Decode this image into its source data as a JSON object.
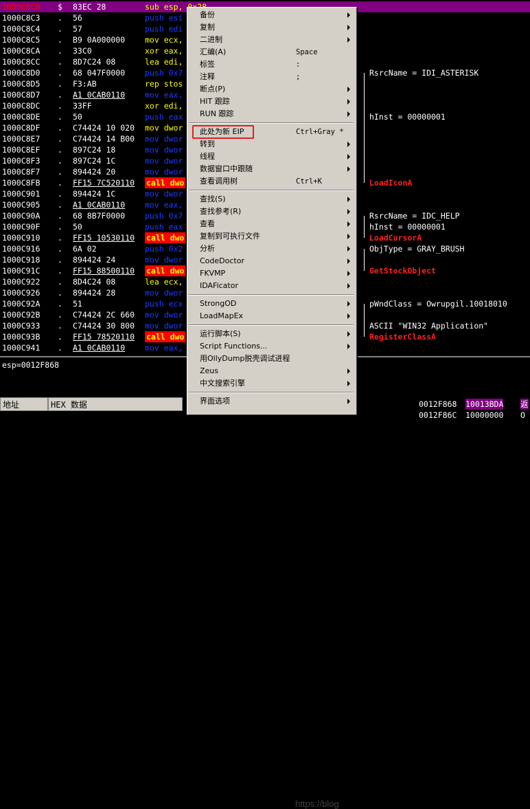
{
  "disasm": {
    "rows": [
      {
        "addr": "1000C8C0",
        "mark": "$",
        "hex": "83EC 28",
        "asm": "sub esp, 0x28",
        "asm_color": "yellow",
        "selected": true
      },
      {
        "addr": "1000C8C3",
        "mark": ".",
        "hex": "56",
        "asm": "push esi",
        "asm_color": "blue"
      },
      {
        "addr": "1000C8C4",
        "mark": ".",
        "hex": "57",
        "asm": "push edi",
        "asm_color": "blue"
      },
      {
        "addr": "1000C8C5",
        "mark": ".",
        "hex": "B9 0A000000",
        "asm": "mov ecx,",
        "asm_color": "yellow"
      },
      {
        "addr": "1000C8CA",
        "mark": ".",
        "hex": "33C0",
        "asm": "xor eax,",
        "asm_color": "yellow"
      },
      {
        "addr": "1000C8CC",
        "mark": ".",
        "hex": "8D7C24 08",
        "asm": "lea edi,",
        "asm_color": "yellow"
      },
      {
        "addr": "1000C8D0",
        "mark": ".",
        "hex": "68 047F0000",
        "asm": "push 0x7",
        "asm_color": "blue"
      },
      {
        "addr": "1000C8D5",
        "mark": ".",
        "hex": "F3:AB",
        "asm": "rep stos",
        "asm_color": "yellow"
      },
      {
        "addr": "1000C8D7",
        "mark": ".",
        "hex": "A1 0CAB0110",
        "asm": "mov eax,",
        "asm_color": "blue",
        "hex_u": true
      },
      {
        "addr": "1000C8DC",
        "mark": ".",
        "hex": "33FF",
        "asm": "xor edi,",
        "asm_color": "yellow"
      },
      {
        "addr": "1000C8DE",
        "mark": ".",
        "hex": "50",
        "asm": "push eax",
        "asm_color": "blue"
      },
      {
        "addr": "1000C8DF",
        "mark": ".",
        "hex": "C74424 10 020",
        "asm": "mov dwor",
        "asm_color": "yellow"
      },
      {
        "addr": "1000C8E7",
        "mark": ".",
        "hex": "C74424 14 B00",
        "asm": "mov dwor",
        "asm_color": "blue"
      },
      {
        "addr": "1000C8EF",
        "mark": ".",
        "hex": "897C24 18",
        "asm": "mov dwor",
        "asm_color": "blue"
      },
      {
        "addr": "1000C8F3",
        "mark": ".",
        "hex": "897C24 1C",
        "asm": "mov dwor",
        "asm_color": "blue"
      },
      {
        "addr": "1000C8F7",
        "mark": ".",
        "hex": "894424 20",
        "asm": "mov dwor",
        "asm_color": "blue"
      },
      {
        "addr": "1000C8FB",
        "mark": ".",
        "hex": "FF15 7C520110",
        "asm": "call dwo",
        "asm_color": "call",
        "hex_u": true
      },
      {
        "addr": "1000C901",
        "mark": ".",
        "hex": "894424 1C",
        "asm": "mov dwor",
        "asm_color": "blue"
      },
      {
        "addr": "1000C905",
        "mark": ".",
        "hex": "A1 0CAB0110",
        "asm": "mov eax,",
        "asm_color": "blue",
        "hex_u": true
      },
      {
        "addr": "1000C90A",
        "mark": ".",
        "hex": "68 8B7F0000",
        "asm": "push 0x7",
        "asm_color": "blue"
      },
      {
        "addr": "1000C90F",
        "mark": ".",
        "hex": "50",
        "asm": "push eax",
        "asm_color": "blue"
      },
      {
        "addr": "1000C910",
        "mark": ".",
        "hex": "FF15 10530110",
        "asm": "call dwo",
        "asm_color": "call",
        "hex_u": true
      },
      {
        "addr": "1000C916",
        "mark": ".",
        "hex": "6A 02",
        "asm": "push 0x2",
        "asm_color": "blue"
      },
      {
        "addr": "1000C918",
        "mark": ".",
        "hex": "894424 24",
        "asm": "mov dwor",
        "asm_color": "blue"
      },
      {
        "addr": "1000C91C",
        "mark": ".",
        "hex": "FF15 88500110",
        "asm": "call dwo",
        "asm_color": "call",
        "hex_u": true
      },
      {
        "addr": "1000C922",
        "mark": ".",
        "hex": "8D4C24 08",
        "asm": "lea ecx,",
        "asm_color": "yellow"
      },
      {
        "addr": "1000C926",
        "mark": ".",
        "hex": "894424 28",
        "asm": "mov dwor",
        "asm_color": "blue"
      },
      {
        "addr": "1000C92A",
        "mark": ".",
        "hex": "51",
        "asm": "push ecx",
        "asm_color": "blue"
      },
      {
        "addr": "1000C92B",
        "mark": ".",
        "hex": "C74424 2C 660",
        "asm": "mov dwor",
        "asm_color": "blue"
      },
      {
        "addr": "1000C933",
        "mark": ".",
        "hex": "C74424 30 800",
        "asm": "mov dwor",
        "asm_color": "blue"
      },
      {
        "addr": "1000C93B",
        "mark": ".",
        "hex": "FF15 78520110",
        "asm": "call dwo",
        "asm_color": "call",
        "hex_u": true
      },
      {
        "addr": "1000C941",
        "mark": ".",
        "hex": "A1 0CAB0110",
        "asm": "mov eax,",
        "asm_color": "blue",
        "hex_u": true
      }
    ],
    "comments": [
      {
        "row": 6,
        "text": "RsrcName = IDI_ASTERISK",
        "color": "white"
      },
      {
        "row": 10,
        "text": "hInst = 00000001",
        "color": "white"
      },
      {
        "row": 16,
        "text": "LoadIconA",
        "color": "red"
      },
      {
        "row": 19,
        "text": "RsrcName = IDC_HELP",
        "color": "white"
      },
      {
        "row": 20,
        "text": "hInst = 00000001",
        "color": "white"
      },
      {
        "row": 21,
        "text": "LoadCursorA",
        "color": "red"
      },
      {
        "row": 22,
        "text": "ObjType = GRAY_BRUSH",
        "color": "white"
      },
      {
        "row": 24,
        "text": "GetStockObject",
        "color": "red"
      },
      {
        "row": 27,
        "text": "pWndClass = Owrupgil.10018010",
        "color": "white"
      },
      {
        "row": 29,
        "text": "ASCII \"WIN32 Application\"",
        "color": "white"
      },
      {
        "row": 30,
        "text": "RegisterClassA",
        "color": "red"
      }
    ]
  },
  "infobar": {
    "text": "esp=0012F868"
  },
  "bottom": {
    "addr_header": "地址",
    "hex_header": "HEX 数据",
    "stack": [
      {
        "addr": "0012F868",
        "value": "10013BDA",
        "extra": "返",
        "highlight": true
      },
      {
        "addr": "0012F86C",
        "value": "10000000",
        "extra": "O",
        "highlight": false
      }
    ]
  },
  "context_menu": {
    "items": [
      {
        "type": "item",
        "label": "备份",
        "shortcut": "",
        "submenu": true
      },
      {
        "type": "item",
        "label": "复制",
        "shortcut": "",
        "submenu": true
      },
      {
        "type": "item",
        "label": "二进制",
        "shortcut": "",
        "submenu": true
      },
      {
        "type": "item",
        "label": "汇编(A)",
        "shortcut": "Space",
        "submenu": false
      },
      {
        "type": "item",
        "label": "标签",
        "shortcut": ":",
        "submenu": false
      },
      {
        "type": "item",
        "label": "注释",
        "shortcut": ";",
        "submenu": false
      },
      {
        "type": "item",
        "label": "断点(P)",
        "shortcut": "",
        "submenu": true
      },
      {
        "type": "item",
        "label": "HIT 跟踪",
        "shortcut": "",
        "submenu": true
      },
      {
        "type": "item",
        "label": "RUN 跟踪",
        "shortcut": "",
        "submenu": true
      },
      {
        "type": "sep"
      },
      {
        "type": "item",
        "label": "此处为新 EIP",
        "shortcut": "Ctrl+Gray *",
        "submenu": false,
        "highlight": true
      },
      {
        "type": "item",
        "label": "转到",
        "shortcut": "",
        "submenu": true
      },
      {
        "type": "item",
        "label": "线程",
        "shortcut": "",
        "submenu": true
      },
      {
        "type": "item",
        "label": "数据窗口中跟随",
        "shortcut": "",
        "submenu": true
      },
      {
        "type": "item",
        "label": "查看调用树",
        "shortcut": "Ctrl+K",
        "submenu": false
      },
      {
        "type": "sep"
      },
      {
        "type": "item",
        "label": "查找(S)",
        "shortcut": "",
        "submenu": true
      },
      {
        "type": "item",
        "label": "查找参考(R)",
        "shortcut": "",
        "submenu": true
      },
      {
        "type": "item",
        "label": "查看",
        "shortcut": "",
        "submenu": true
      },
      {
        "type": "item",
        "label": "复制到可执行文件",
        "shortcut": "",
        "submenu": true
      },
      {
        "type": "item",
        "label": "分析",
        "shortcut": "",
        "submenu": true
      },
      {
        "type": "item",
        "label": "CodeDoctor",
        "shortcut": "",
        "submenu": true
      },
      {
        "type": "item",
        "label": "FKVMP",
        "shortcut": "",
        "submenu": true
      },
      {
        "type": "item",
        "label": "IDAFicator",
        "shortcut": "",
        "submenu": true
      },
      {
        "type": "sep"
      },
      {
        "type": "item",
        "label": "StrongOD",
        "shortcut": "",
        "submenu": true
      },
      {
        "type": "item",
        "label": "LoadMapEx",
        "shortcut": "",
        "submenu": true
      },
      {
        "type": "sep"
      },
      {
        "type": "item",
        "label": "运行脚本(S)",
        "shortcut": "",
        "submenu": true
      },
      {
        "type": "item",
        "label": "Script Functions...",
        "shortcut": "",
        "submenu": true
      },
      {
        "type": "item",
        "label": "用OllyDump脱壳调试进程",
        "shortcut": "",
        "submenu": false
      },
      {
        "type": "item",
        "label": "Zeus",
        "shortcut": "",
        "submenu": true
      },
      {
        "type": "item",
        "label": "中文搜索引擎",
        "shortcut": "",
        "submenu": true
      },
      {
        "type": "sep"
      },
      {
        "type": "item",
        "label": "界面选项",
        "shortcut": "",
        "submenu": true
      }
    ]
  }
}
